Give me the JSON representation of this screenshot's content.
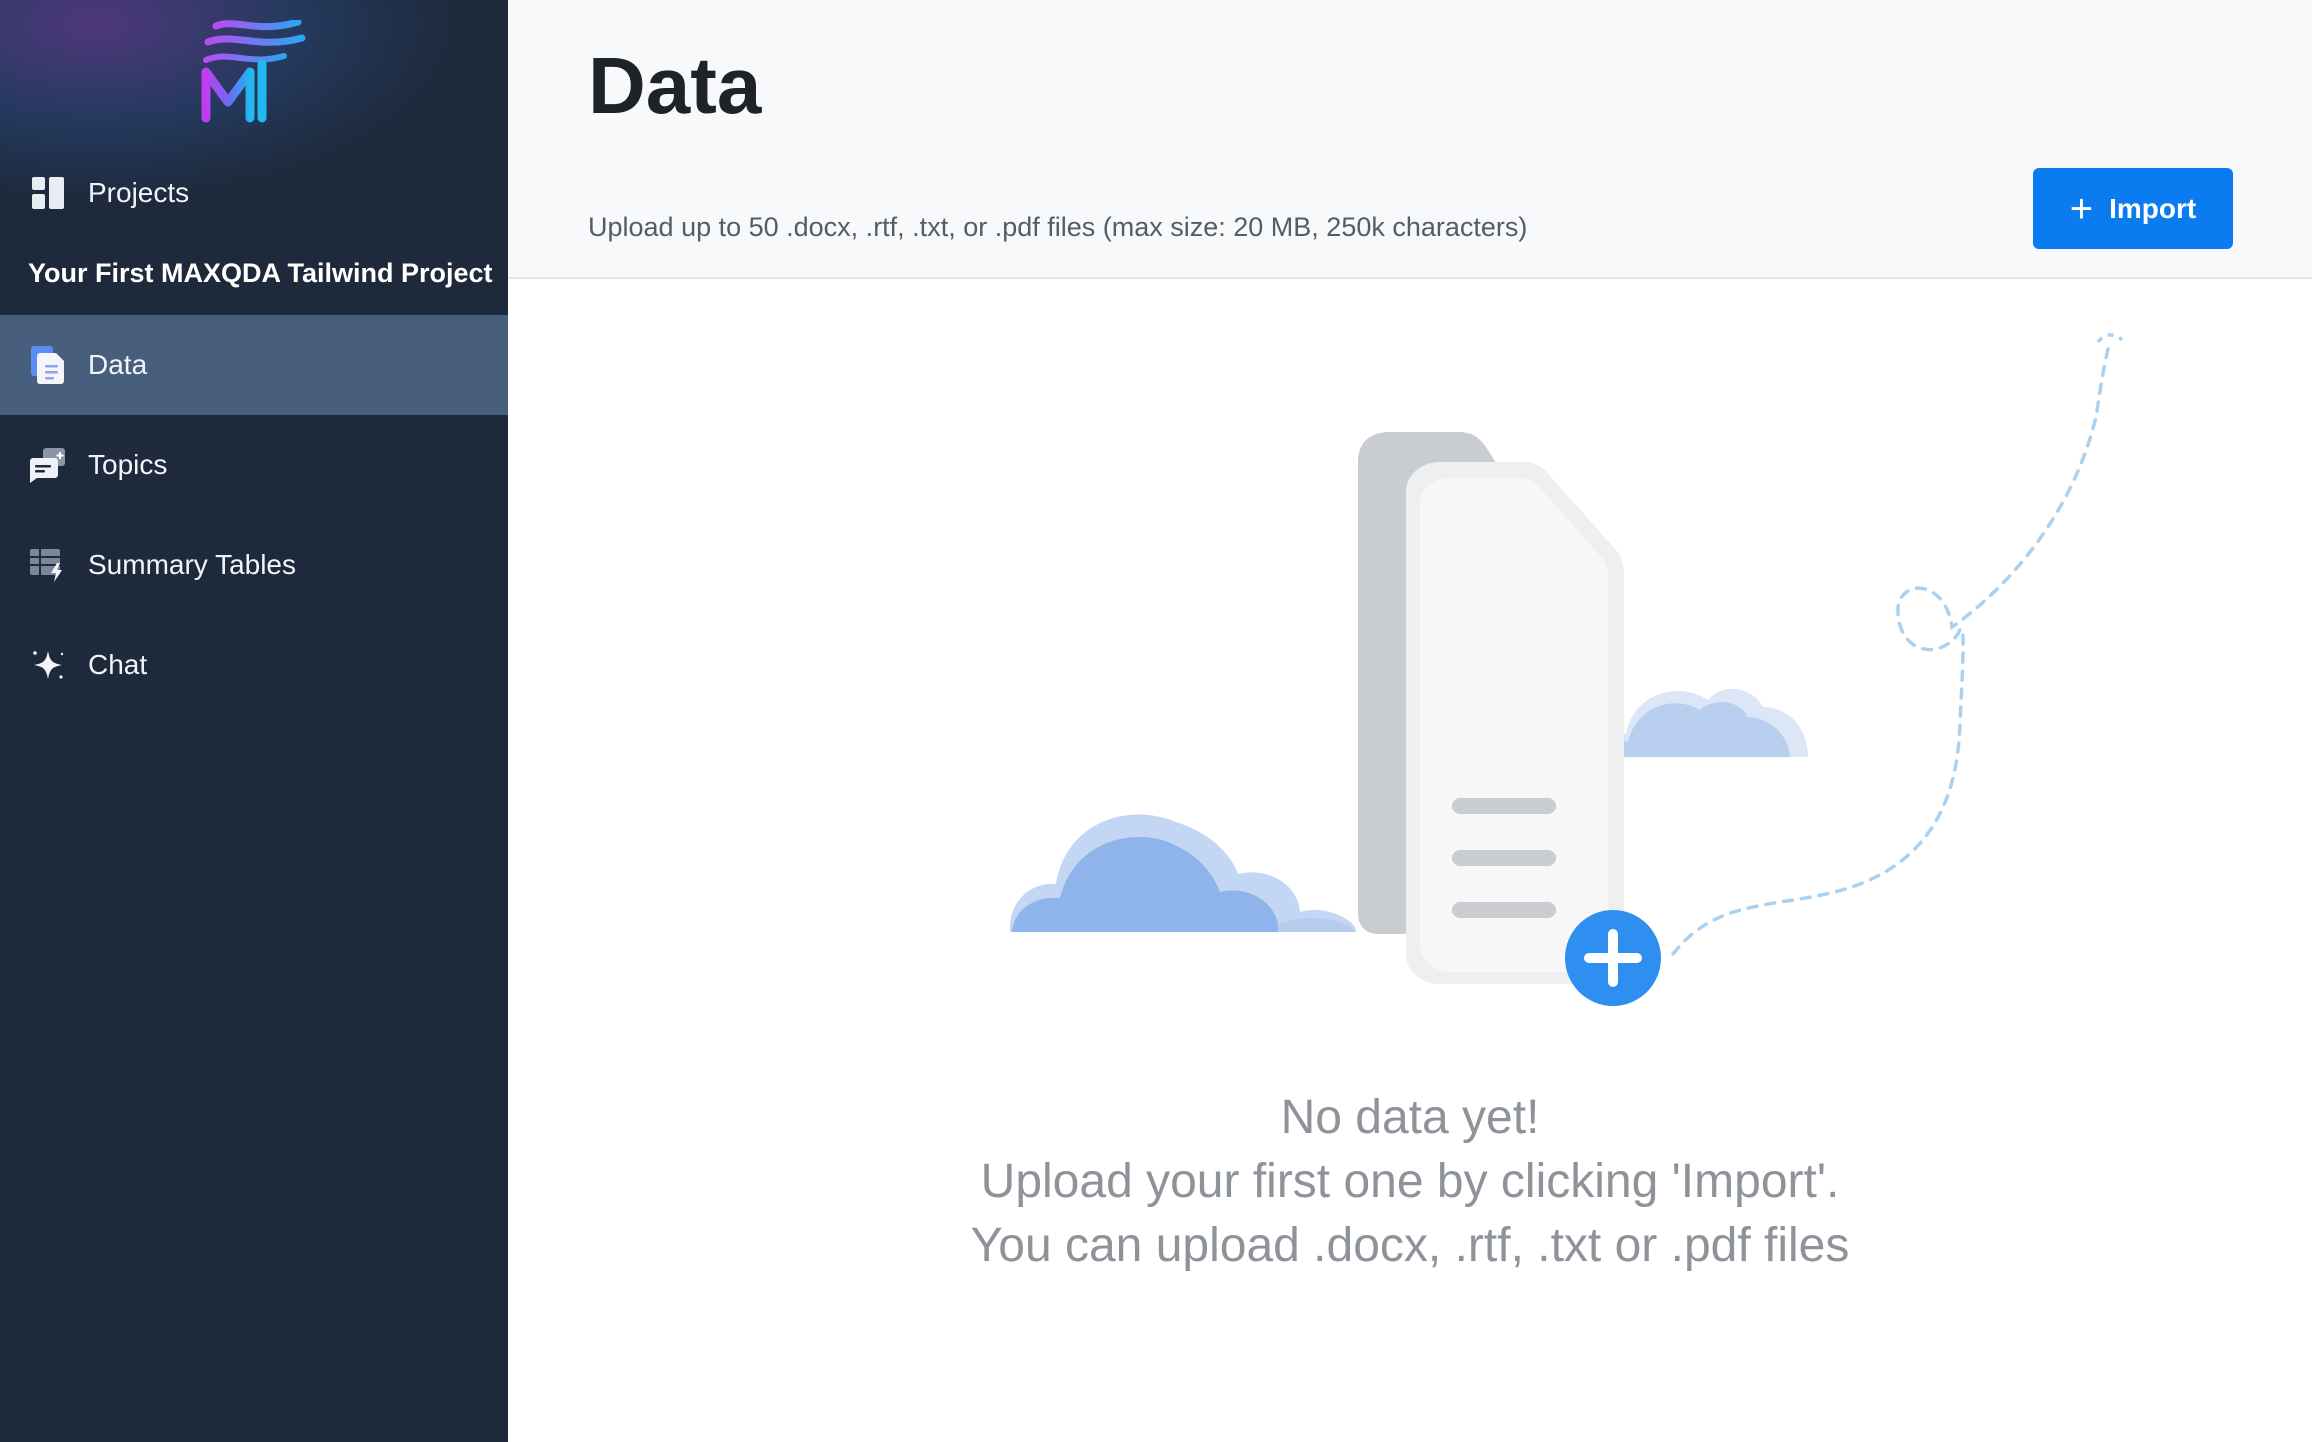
{
  "sidebar": {
    "logo_name": "maxqda-tailwind-logo",
    "projects_label": "Projects",
    "project_title": "Your First MAXQDA Tailwind Project",
    "items": [
      {
        "label": "Data",
        "icon": "document-icon",
        "active": true
      },
      {
        "label": "Topics",
        "icon": "comment-icon",
        "active": false
      },
      {
        "label": "Summary Tables",
        "icon": "table-icon",
        "active": false
      },
      {
        "label": "Chat",
        "icon": "sparkle-icon",
        "active": false
      }
    ]
  },
  "header": {
    "title": "Data",
    "subtitle": "Upload up to 50 .docx, .rtf, .txt, or .pdf files (max size: 20 MB, 250k characters)",
    "import_label": "Import"
  },
  "empty_state": {
    "line1": "No data yet!",
    "line2": "Upload your first one by clicking 'Import'.",
    "line3": "You can upload .docx, .rtf, .txt or .pdf files"
  },
  "colors": {
    "sidebar_bg": "#1e293b",
    "sidebar_active": "#475f7d",
    "accent": "#0a7cf0",
    "cloud": "#8fb4ec",
    "plus_badge": "#2f8ff0"
  }
}
